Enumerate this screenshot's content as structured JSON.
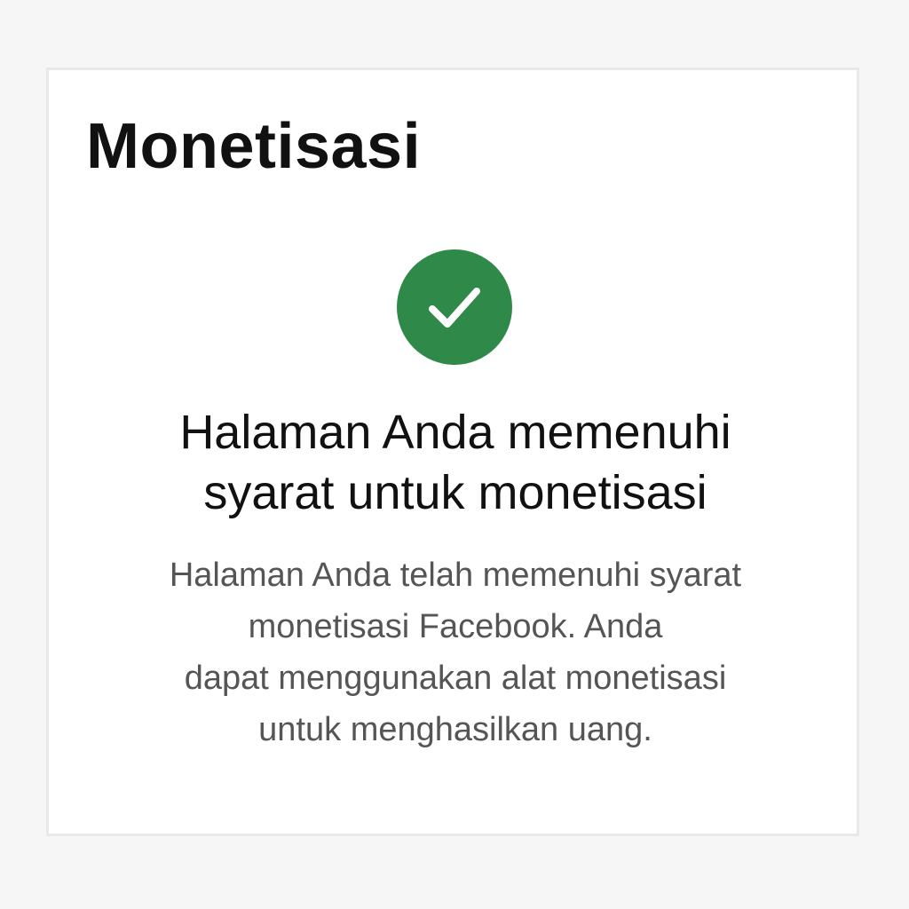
{
  "page": {
    "title": "Monetisasi"
  },
  "status": {
    "icon": "check-circle-icon",
    "color": "#2f8a49",
    "headline_lines": [
      "Halaman Anda memenuhi",
      "syarat untuk monetisasi"
    ],
    "description_lines": [
      "Halaman Anda telah memenuhi syarat",
      "monetisasi Facebook. Anda",
      "dapat menggunakan alat monetisasi",
      "untuk menghasilkan uang."
    ]
  }
}
